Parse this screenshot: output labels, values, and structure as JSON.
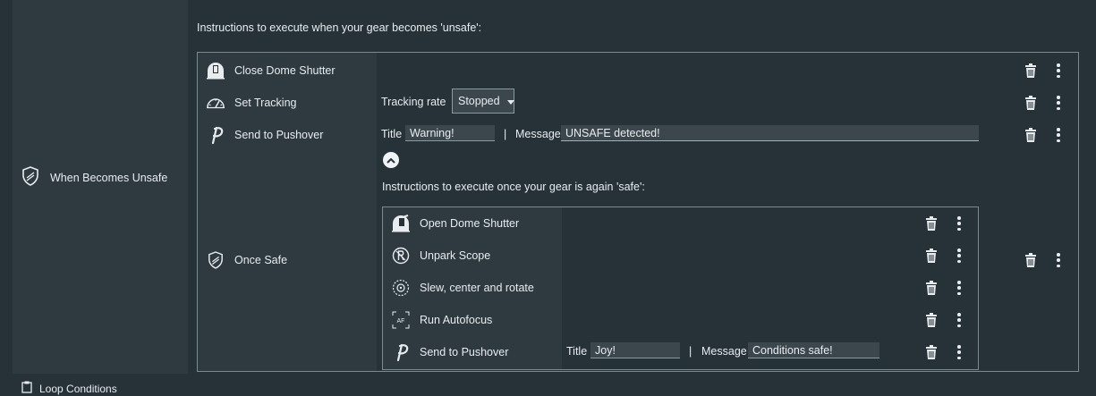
{
  "trigger": {
    "label": "When Becomes Unsafe",
    "icon": "shield-icon"
  },
  "unsafe_section": {
    "heading": "Instructions to execute when your gear becomes 'unsafe':",
    "items": [
      {
        "name": "Close Dome Shutter",
        "icon": "dome-icon"
      },
      {
        "name": "Set Tracking",
        "icon": "speedometer-icon",
        "rate_label": "Tracking rate",
        "rate_value": "Stopped"
      },
      {
        "name": "Send to Pushover",
        "icon": "pushover-icon",
        "title_label": "Title",
        "title_value": "Warning!",
        "separator": "|",
        "message_label": "Message",
        "message_value": "UNSAFE detected!"
      },
      {
        "name": "Once Safe",
        "icon": "shield-icon"
      }
    ]
  },
  "safe_section": {
    "heading": "Instructions to execute once your gear is again 'safe':",
    "items": [
      {
        "name": "Open Dome Shutter",
        "icon": "dome-open-icon"
      },
      {
        "name": "Unpark Scope",
        "icon": "unpark-icon"
      },
      {
        "name": "Slew, center and rotate",
        "icon": "slew-icon"
      },
      {
        "name": "Run Autofocus",
        "icon": "autofocus-icon",
        "icon_text": "AF"
      },
      {
        "name": "Send to Pushover",
        "icon": "pushover-icon",
        "title_label": "Title",
        "title_value": "Joy!",
        "separator": "|",
        "message_label": "Message",
        "message_value": "Conditions safe!"
      }
    ]
  },
  "bottom": {
    "label": "Loop Conditions"
  }
}
